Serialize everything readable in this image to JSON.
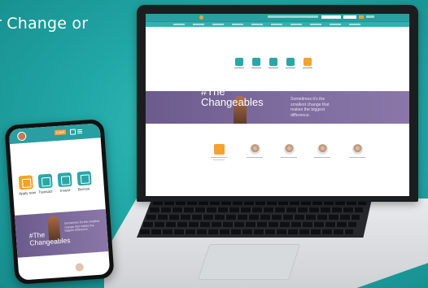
{
  "headline": "r Change or",
  "colors": {
    "teal_bg": "#22a9a8",
    "header_teal": "#2a9fa1",
    "accent_orange": "#f4a230",
    "hero_purple": "#7e6b9e"
  },
  "laptop": {
    "hero": {
      "title_line1": "#The",
      "title_line2": "Changeables",
      "subtitle": "Sometimes it's the smallest change that makes the biggest difference."
    }
  },
  "phone": {
    "header": {
      "login_label": "Login"
    },
    "tiles": [
      {
        "label": "Apply now",
        "icon": "apply-icon",
        "color": "orange"
      },
      {
        "label": "Transact",
        "icon": "transact-icon",
        "color": "teal"
      },
      {
        "label": "Invest",
        "icon": "invest-icon",
        "color": "teal"
      },
      {
        "label": "Borrow",
        "icon": "borrow-icon",
        "color": "teal"
      }
    ],
    "hero": {
      "title_line1": "#The",
      "title_line2": "Changeables",
      "subtitle": "Sometimes it's the smallest change that makes the biggest difference."
    }
  }
}
